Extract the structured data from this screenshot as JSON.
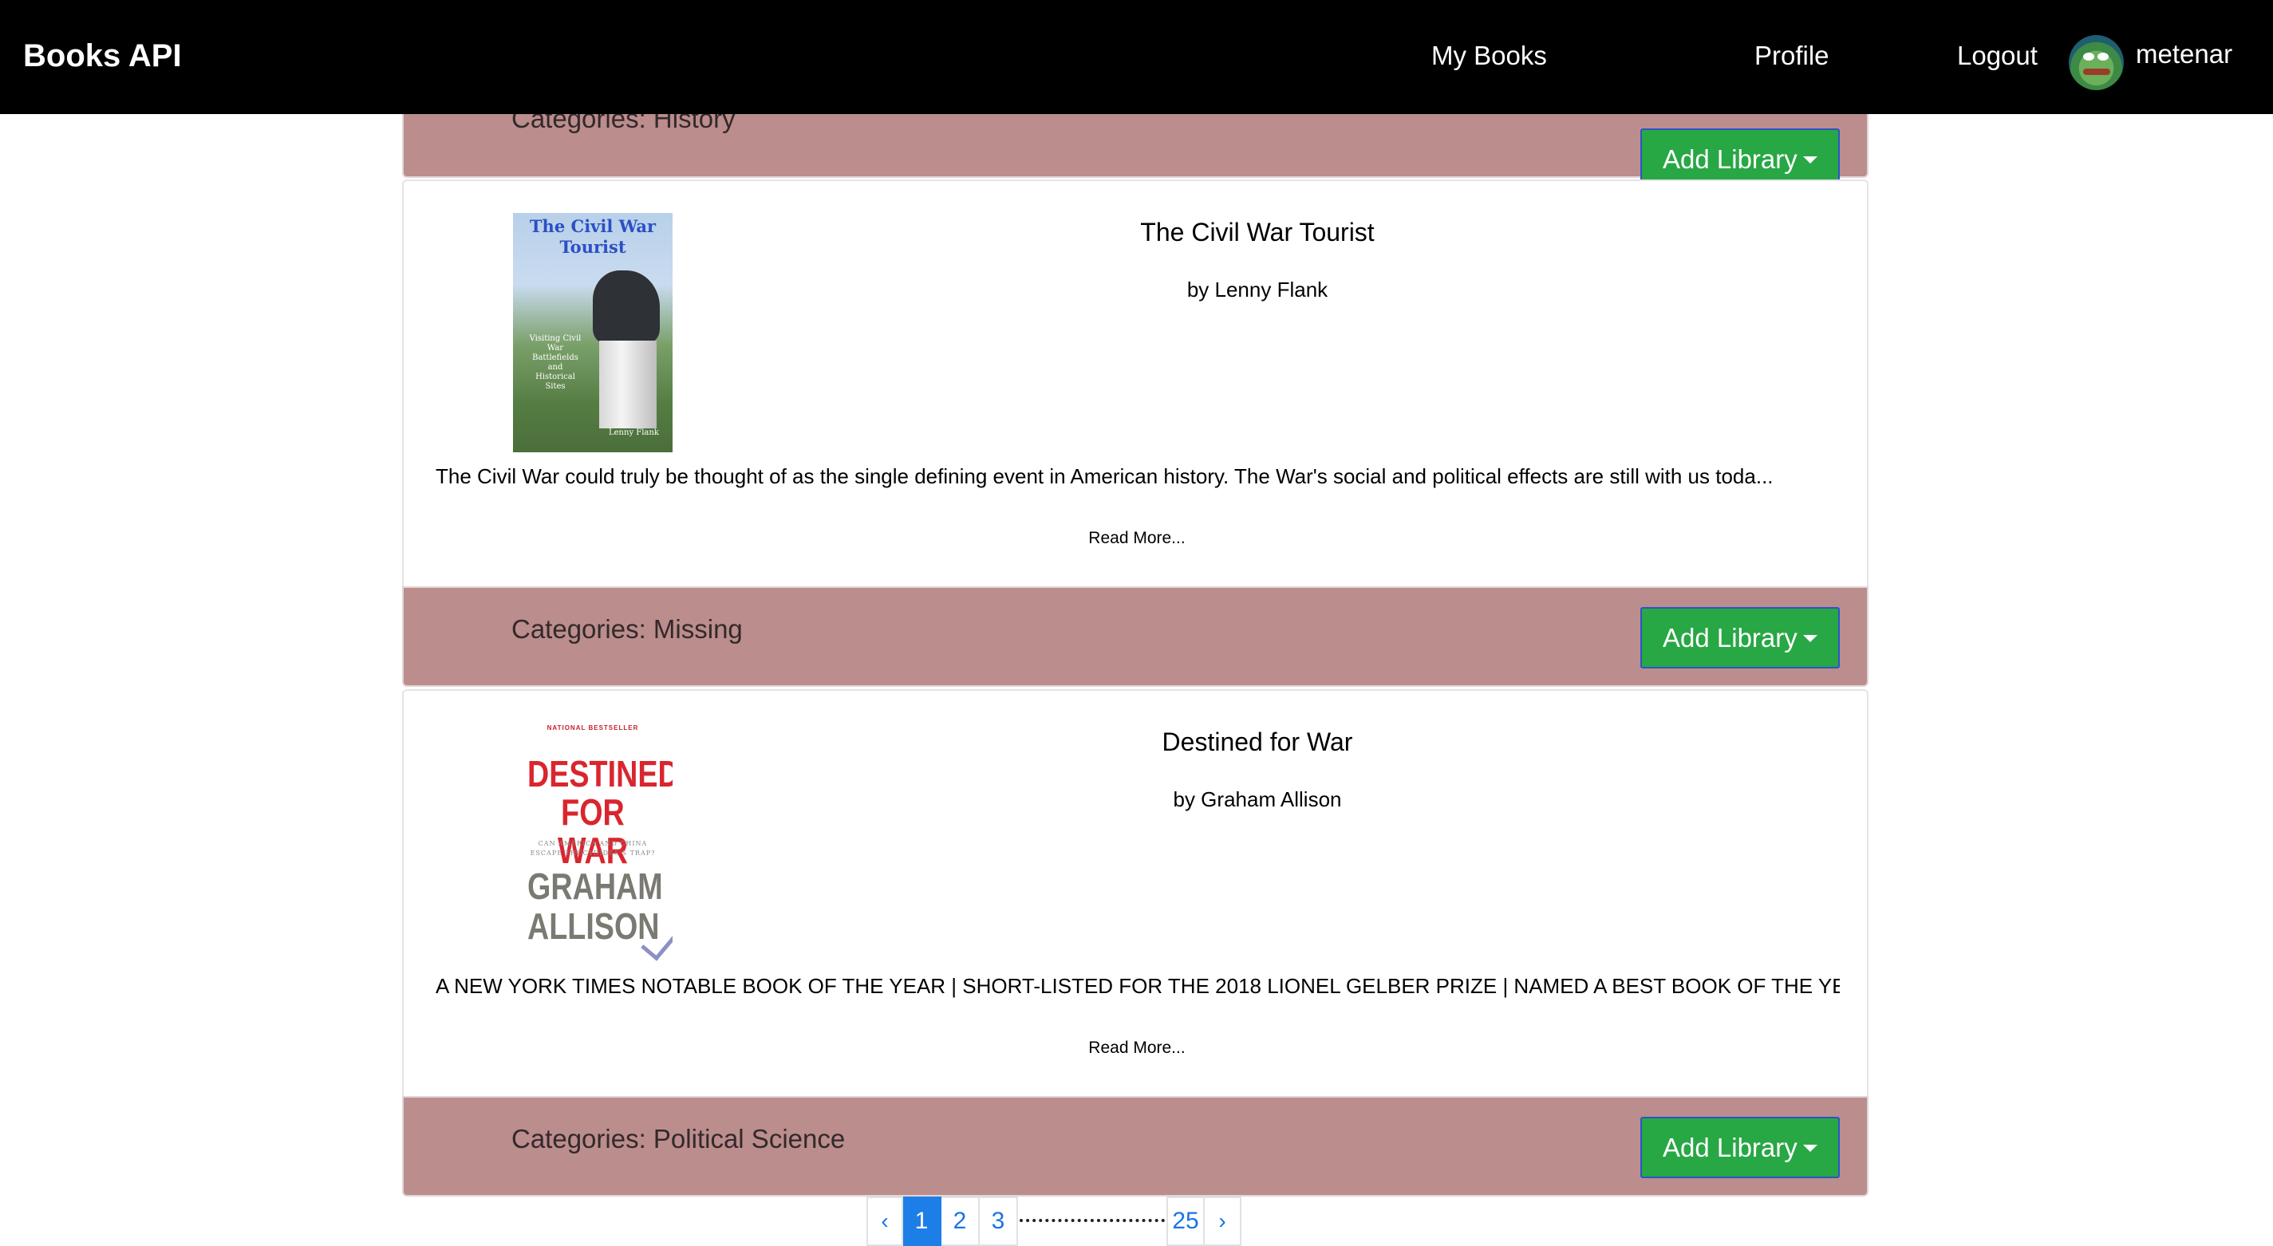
{
  "navbar": {
    "brand": "Books API",
    "links": {
      "my_books": "My Books",
      "profile": "Profile",
      "logout": "Logout"
    },
    "user": {
      "username": "metenar",
      "avatar_icon": "frog-avatar-icon"
    }
  },
  "cards": [
    {
      "categories": "Categories: History",
      "add_library_label": "Add Library"
    },
    {
      "cover": {
        "title": "The Civil War Tourist",
        "subtitle": "Visiting Civil War Battlefields and Historical Sites",
        "author": "Lenny Flank"
      },
      "title": "The Civil War Tourist",
      "author": "by Lenny Flank",
      "description": "The Civil War could truly be thought of as the single defining event in American history. The War's social and political effects are still with us toda...",
      "read_more": "Read More...",
      "categories": "Categories: Missing",
      "add_library_label": "Add Library"
    },
    {
      "cover": {
        "badge": "NATIONAL BESTSELLER",
        "title_line1": "DESTINED",
        "title_line2": "FOR WAR",
        "subtitle": "CAN AMERICA AND CHINA ESCAPE THUCYDIDES'S TRAP?",
        "author_line1": "GRAHAM",
        "author_line2": "ALLISON"
      },
      "title": "Destined for War",
      "author": "by Graham Allison",
      "description": "A NEW YORK TIMES NOTABLE BOOK OF THE YEAR | SHORT-LISTED FOR THE 2018 LIONEL GELBER PRIZE | NAMED A BEST BOOK OF THE YEA...",
      "read_more": "Read More...",
      "categories": "Categories: Political Science",
      "add_library_label": "Add Library"
    }
  ],
  "pagination": {
    "prev": "‹",
    "pages": [
      "1",
      "2",
      "3"
    ],
    "last_page": "25",
    "next": "›",
    "active_page": "1"
  },
  "colors": {
    "navbar_bg": "#000000",
    "card_footer_bg": "#bc8d8d",
    "add_library_bg": "#28a745",
    "pagination_active": "#1e7ee8"
  }
}
